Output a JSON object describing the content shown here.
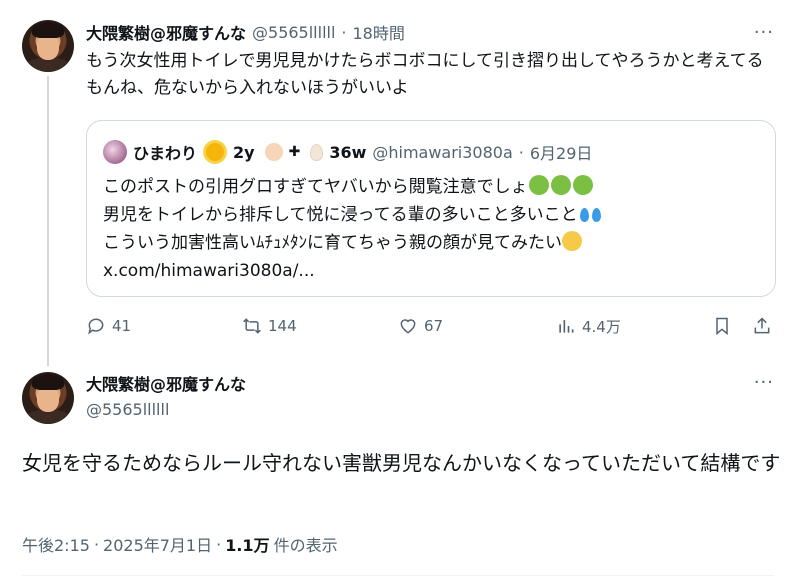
{
  "tweet1": {
    "author_name": "大隈繁樹@邪魔すんな",
    "handle": "@5565llllll",
    "sep": "·",
    "time": "18時間",
    "more": "···",
    "text": "もう次女性用トイレで男児見かけたらボコボコにして引き摺り出してやろうかと考えてるもんね、危ないから入れないほうがいいよ",
    "quote": {
      "author_name": "ひまわり",
      "badge_a": "2y",
      "badge_b": "36w",
      "plus": "✚",
      "handle": "@himawari3080a",
      "sep": "·",
      "date": "6月29日",
      "line1": "このポストの引用グロすぎてヤバいから閲覧注意でしょ",
      "line2": "男児をトイレから排斥して悦に浸ってる輩の多いこと多いこと",
      "line3": "こういう加害性高いﾑﾁｭﾒﾀﾝに育てちゃう親の顔が見てみたい",
      "link": "x.com/himawari3080a/..."
    },
    "actions": {
      "replies": "41",
      "reposts": "144",
      "likes": "67",
      "views": "4.4万"
    }
  },
  "tweet2": {
    "author_name": "大隈繁樹@邪魔すんな",
    "handle": "@5565llllll",
    "more": "···",
    "text": "女児を守るためならルール守れない害獣男児なんかいなくなっていただいて結構です",
    "time": "午後2:15",
    "sep": "·",
    "date": "2025年7月1日",
    "views_count": "1.1万",
    "views_label": "件の表示"
  }
}
